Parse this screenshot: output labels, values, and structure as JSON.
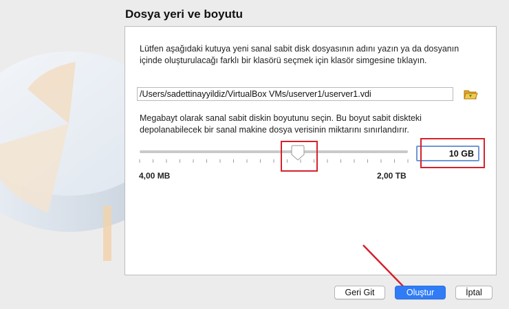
{
  "title": "Dosya yeri ve boyutu",
  "location": {
    "description": "Lütfen aşağıdaki kutuya yeni sanal sabit disk dosyasının adını yazın ya da dosyanın içinde oluşturulacağı farklı bir klasörü seçmek için klasör simgesine tıklayın.",
    "path_value": "/Users/sadettinayyildiz/VirtualBox VMs/userver1/userver1.vdi",
    "folder_icon": "folder-open-icon"
  },
  "size": {
    "description": "Megabayt olarak sanal sabit diskin boyutunu seçin. Bu boyut sabit diskteki depolanabilecek bir sanal makine dosya verisinin miktarını sınırlandırır.",
    "min_label": "4,00 MB",
    "max_label": "2,00 TB",
    "value": "10 GB",
    "slider_fraction": 0.59
  },
  "buttons": {
    "back": "Geri Git",
    "create": "Oluştur",
    "cancel": "İptal"
  },
  "colors": {
    "accent": "#2f7cf6",
    "annotation": "#d6202a"
  }
}
